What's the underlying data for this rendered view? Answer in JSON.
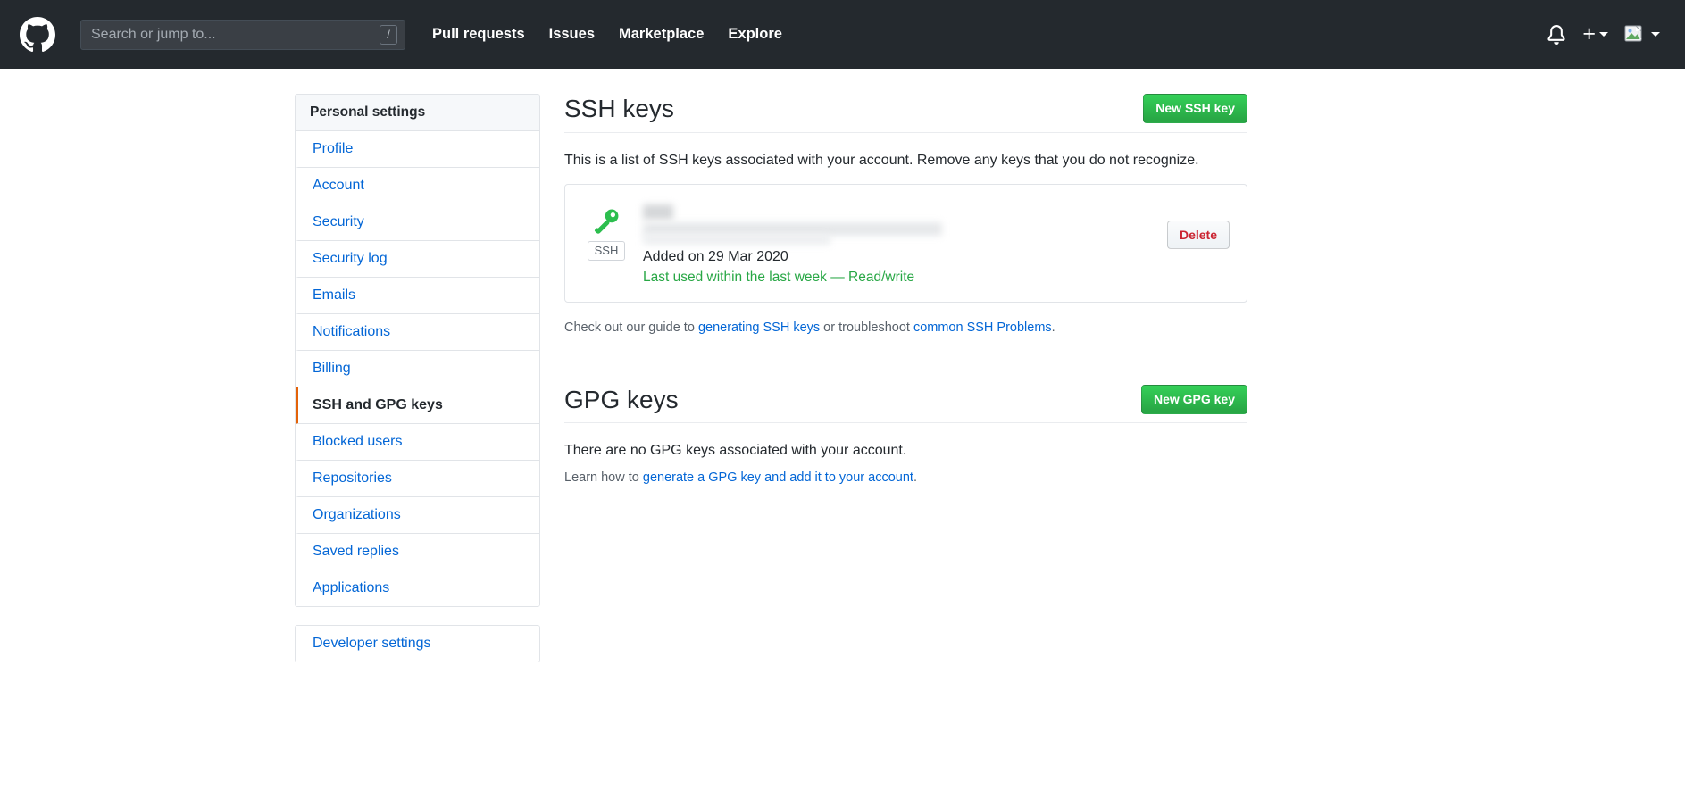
{
  "header": {
    "logo_icon": "github-mark-icon",
    "search": {
      "placeholder": "Search or jump to...",
      "shortcut": "/"
    },
    "nav": [
      {
        "label": "Pull requests"
      },
      {
        "label": "Issues"
      },
      {
        "label": "Marketplace"
      },
      {
        "label": "Explore"
      }
    ],
    "right": {
      "notifications_icon": "bell-icon",
      "create_new_icon": "plus-icon",
      "avatar_icon": "broken-image-avatar-icon"
    }
  },
  "sidebar": {
    "heading": "Personal settings",
    "items": [
      {
        "label": "Profile",
        "selected": false
      },
      {
        "label": "Account",
        "selected": false
      },
      {
        "label": "Security",
        "selected": false
      },
      {
        "label": "Security log",
        "selected": false
      },
      {
        "label": "Emails",
        "selected": false
      },
      {
        "label": "Notifications",
        "selected": false
      },
      {
        "label": "Billing",
        "selected": false
      },
      {
        "label": "SSH and GPG keys",
        "selected": true
      },
      {
        "label": "Blocked users",
        "selected": false
      },
      {
        "label": "Repositories",
        "selected": false
      },
      {
        "label": "Organizations",
        "selected": false
      },
      {
        "label": "Saved replies",
        "selected": false
      },
      {
        "label": "Applications",
        "selected": false
      }
    ],
    "developer_settings": "Developer settings"
  },
  "ssh": {
    "title": "SSH keys",
    "new_button": "New SSH key",
    "description": "This is a list of SSH keys associated with your account. Remove any keys that you do not recognize.",
    "key": {
      "icon": "key-icon",
      "badge": "SSH",
      "name_redacted": "",
      "fingerprint_redacted": "",
      "added": "Added on 29 Mar 2020",
      "last_used": "Last used within the last week — Read/write",
      "delete_button": "Delete"
    },
    "guide": {
      "prefix": "Check out our guide to ",
      "link1": "generating SSH keys",
      "middle": " or troubleshoot ",
      "link2": "common SSH Problems",
      "suffix": "."
    }
  },
  "gpg": {
    "title": "GPG keys",
    "new_button": "New GPG key",
    "empty": "There are no GPG keys associated with your account.",
    "learn": {
      "prefix": "Learn how to ",
      "link": "generate a GPG key and add it to your account",
      "suffix": "."
    }
  },
  "colors": {
    "header_bg": "#24292e",
    "link": "#0366d6",
    "green": "#2cbe4e",
    "selected_indicator": "#e36209",
    "danger": "#cb2431",
    "muted": "#586069"
  }
}
